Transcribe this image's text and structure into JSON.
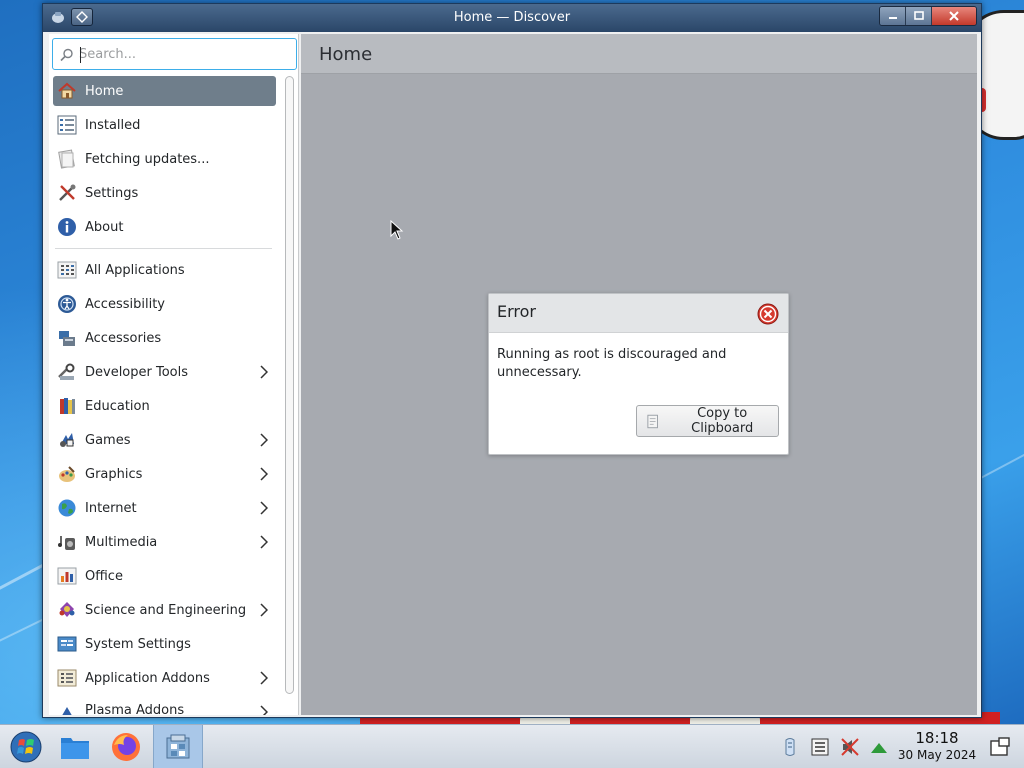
{
  "window": {
    "title": "Home — Discover"
  },
  "search": {
    "placeholder": "Search..."
  },
  "sidebar": {
    "items": [
      {
        "label": "Home",
        "icon": "home-icon",
        "active": true,
        "chevron": false
      },
      {
        "label": "Installed",
        "icon": "installed-list-icon",
        "chevron": false
      },
      {
        "label": "Fetching updates...",
        "icon": "updates-icon",
        "chevron": false
      },
      {
        "label": "Settings",
        "icon": "settings-tools-icon",
        "chevron": false
      },
      {
        "label": "About",
        "icon": "info-icon",
        "chevron": false
      }
    ],
    "categories": [
      {
        "label": "All Applications",
        "icon": "grid-icon",
        "chevron": false
      },
      {
        "label": "Accessibility",
        "icon": "accessibility-icon",
        "chevron": false
      },
      {
        "label": "Accessories",
        "icon": "accessories-icon",
        "chevron": false
      },
      {
        "label": "Developer Tools",
        "icon": "developer-tools-icon",
        "chevron": true
      },
      {
        "label": "Education",
        "icon": "education-icon",
        "chevron": false
      },
      {
        "label": "Games",
        "icon": "games-icon",
        "chevron": true
      },
      {
        "label": "Graphics",
        "icon": "graphics-icon",
        "chevron": true
      },
      {
        "label": "Internet",
        "icon": "internet-globe-icon",
        "chevron": true
      },
      {
        "label": "Multimedia",
        "icon": "multimedia-icon",
        "chevron": true
      },
      {
        "label": "Office",
        "icon": "office-chart-icon",
        "chevron": false
      },
      {
        "label": "Science and Engineering",
        "icon": "science-icon",
        "chevron": true
      },
      {
        "label": "System Settings",
        "icon": "system-settings-icon",
        "chevron": false
      },
      {
        "label": "Application Addons",
        "icon": "addons-icon",
        "chevron": true
      },
      {
        "label": "Plasma Addons",
        "icon": "plasma-addons-icon",
        "chevron": true
      }
    ]
  },
  "main": {
    "title": "Home"
  },
  "dialog": {
    "title": "Error",
    "message": "Running as root is discouraged and unnecessary.",
    "copy_label": "Copy to Clipboard"
  },
  "taskbar": {
    "time": "18:18",
    "date": "30 May 2024"
  },
  "colors": {
    "accent": "#3daee9",
    "active_item": "#6f7e8b",
    "titlebar": "#2a4668",
    "error_red": "#d63a2f"
  }
}
